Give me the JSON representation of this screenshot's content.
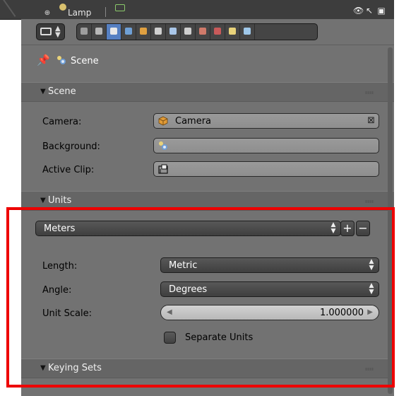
{
  "outliner": {
    "item_label": "Lamp"
  },
  "header": {
    "editor_icon": "properties-editor-icon",
    "tabs": [
      {
        "icon": "render-icon",
        "color": "#9d9d9d"
      },
      {
        "icon": "render-layers-icon",
        "color": "#b7b7b7"
      },
      {
        "icon": "scene-icon",
        "color": "#e8e8e8",
        "active": true
      },
      {
        "icon": "world-icon",
        "color": "#6fa0d6"
      },
      {
        "icon": "object-icon",
        "color": "#e0a040"
      },
      {
        "icon": "constraints-icon",
        "color": "#cfcfcf"
      },
      {
        "icon": "modifiers-icon",
        "color": "#a9c6e8"
      },
      {
        "icon": "data-icon",
        "color": "#cfcfcf"
      },
      {
        "icon": "material-icon",
        "color": "#d07a6a"
      },
      {
        "icon": "texture-icon",
        "color": "#c85a5a"
      },
      {
        "icon": "particles-icon",
        "color": "#e8d27a"
      },
      {
        "icon": "physics-icon",
        "color": "#9fc8ea"
      }
    ]
  },
  "breadcrumb": {
    "label": "Scene"
  },
  "scene_panel": {
    "title": "Scene",
    "camera_label": "Camera:",
    "camera_value": "Camera",
    "background_label": "Background:",
    "background_value": "",
    "active_clip_label": "Active Clip:",
    "active_clip_value": ""
  },
  "units_panel": {
    "title": "Units",
    "preset_value": "Meters",
    "length_label": "Length:",
    "length_value": "Metric",
    "angle_label": "Angle:",
    "angle_value": "Degrees",
    "unit_scale_label": "Unit Scale:",
    "unit_scale_value": "1.000000",
    "separate_units_label": "Separate Units",
    "separate_units_checked": false
  },
  "keying_sets_panel": {
    "title": "Keying Sets"
  },
  "highlight_color": "#ee0000"
}
